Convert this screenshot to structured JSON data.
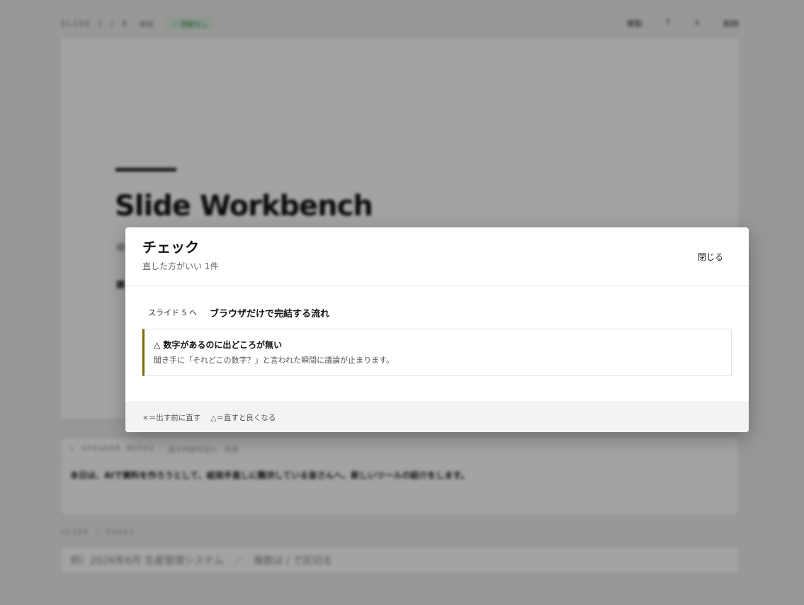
{
  "background": {
    "slide_toolbar": {
      "counter": "SLIDE 1 / 8",
      "layout": "表紙",
      "status": "✓ 問題なし",
      "actions": [
        "複製",
        "↑",
        "↓",
        "削除"
      ]
    },
    "slide": {
      "title": "Slide Workbench",
      "subtitle": "中",
      "presenter": "講"
    },
    "notes": {
      "label": "▸ SPEAKER NOTES",
      "hint": "話す内容を記入 · 任意",
      "text": "本日は、AIで資料を作ろうとして、結局手直しに難渋している皆さんへ、新しいツールの紹介をします。"
    },
    "section_label": "SLIDE / PAGES",
    "footer_input": {
      "value": "例）2026年6月 生産管理システム　／　複数は / で区切る"
    }
  },
  "modal": {
    "title": "チェック",
    "subtitle": "直した方がいい 1件",
    "close_label": "閉じる",
    "groups": [
      {
        "goto_label": "スライド 5 へ",
        "slide_title": "ブラウザだけで完結する流れ",
        "issues": [
          {
            "title": "△ 数字があるのに出どころが無い",
            "description": "聞き手に「それどこの数字？」と言われた瞬間に議論が止まります。",
            "severity_color": "#7a6a00"
          }
        ]
      }
    ],
    "legend": {
      "cross": "×＝出す前に直す",
      "triangle": "△＝直すと良くなる"
    }
  }
}
